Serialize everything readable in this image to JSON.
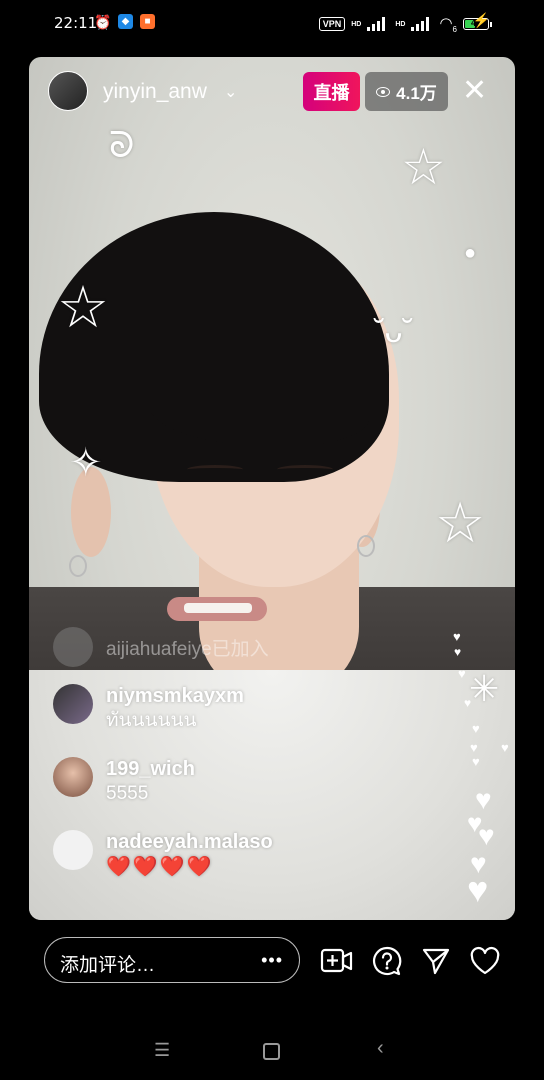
{
  "status_bar": {
    "time": "22:11",
    "vpn": "VPN",
    "hd1": "HD",
    "hd2": "HD",
    "wifi_sub": "6",
    "battery": "47",
    "battery_percent": 47
  },
  "header": {
    "username": "yinyin_anw",
    "live_label": "直播",
    "viewer_count": "4.1万"
  },
  "comments": {
    "joined": "aijiahuafeiye已加入",
    "items": [
      {
        "user": "niymsmkayxm",
        "text": "ทันนนนนน"
      },
      {
        "user": "199_wich",
        "text": "5555"
      },
      {
        "user": "nadeeyah.malaso",
        "text": "❤️❤️❤️❤️"
      }
    ]
  },
  "bottom_bar": {
    "placeholder": "添加评论…",
    "more": "•••"
  },
  "colors": {
    "live_badge": "#e80a6c",
    "heart_emoji": "#e0203a"
  }
}
